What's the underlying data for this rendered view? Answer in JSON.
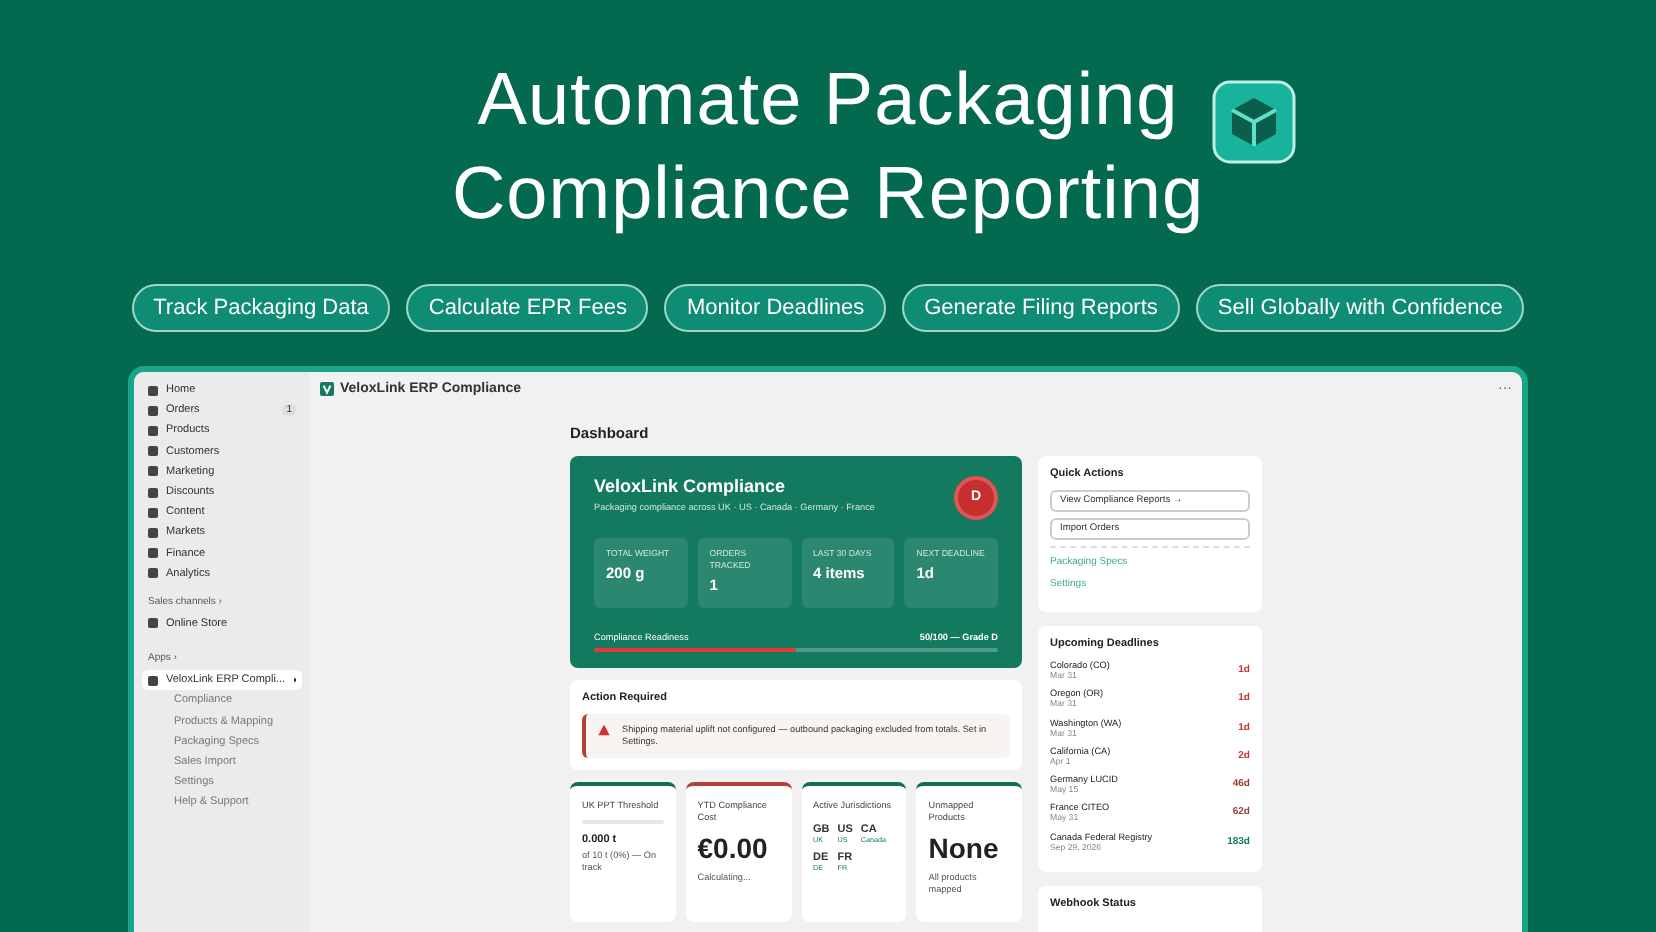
{
  "headline": [
    "Automate Packaging",
    "Compliance Reporting"
  ],
  "features": [
    "Track Packaging Data",
    "Calculate EPR Fees",
    "Monitor Deadlines",
    "Generate Filing Reports",
    "Sell Globally with Confidence"
  ],
  "sidebar": {
    "items": [
      {
        "label": "Home",
        "selected": false
      },
      {
        "label": "Orders",
        "badge": "1",
        "selected": false
      },
      {
        "label": "Products",
        "selected": false
      },
      {
        "label": "Customers",
        "selected": false
      },
      {
        "label": "Marketing",
        "selected": false
      },
      {
        "label": "Discounts",
        "selected": false
      },
      {
        "label": "Content",
        "selected": false
      },
      {
        "label": "Markets",
        "selected": false
      },
      {
        "label": "Finance",
        "selected": false
      },
      {
        "label": "Analytics",
        "selected": false
      }
    ],
    "sales_channels_label": "Sales channels ›",
    "channels": [
      {
        "label": "Online Store",
        "selected": false
      }
    ],
    "apps_label": "Apps ›",
    "app_item": {
      "label": "VeloxLink ERP Compli...",
      "selected": true
    },
    "sub_items": [
      {
        "label": "Compliance",
        "selected": false
      },
      {
        "label": "Products & Mapping",
        "selected": false
      },
      {
        "label": "Packaging Specs",
        "selected": false
      },
      {
        "label": "Sales Import",
        "selected": false
      },
      {
        "label": "Settings",
        "selected": false
      },
      {
        "label": "Help & Support",
        "selected": false
      }
    ]
  },
  "header_title": "VeloxLink ERP Compliance",
  "menu_glyph": "···",
  "page_title": "Dashboard",
  "summary": {
    "title": "VeloxLink Compliance",
    "subtitle": "Packaging compliance across UK · US · Canada · Germany · France",
    "avatar": "D",
    "stats": [
      {
        "label": "TOTAL WEIGHT",
        "value": "200 g"
      },
      {
        "label": "ORDERS TRACKED",
        "value": "1"
      },
      {
        "label": "LAST 30 DAYS",
        "value": "4 items"
      },
      {
        "label": "NEXT DEADLINE",
        "value": "1d"
      }
    ],
    "readiness_label": "Compliance Readiness",
    "readiness_value": "50/100 — Grade D",
    "level": 0.5
  },
  "action": {
    "title": "Action Required",
    "message": "Shipping material uplift not configured — outbound packaging excluded from totals. Set in Settings."
  },
  "cards": [
    {
      "kind": "threshold",
      "title": "UK PPT Threshold",
      "color": "#0f6e56",
      "level": 0,
      "value": "0.000 t",
      "note": "of 10 t (0%) — On track"
    },
    {
      "kind": "cost",
      "title": "YTD Compliance Cost",
      "color": "#b5403a",
      "value": "€0.00",
      "note": "Calculating..."
    },
    {
      "kind": "jurisdictions",
      "title": "Active Jurisdictions",
      "color": "#0f6e56",
      "codes": [
        {
          "code": "GB",
          "name": "UK"
        },
        {
          "code": "US",
          "name": "US"
        },
        {
          "code": "CA",
          "name": "Canada"
        },
        {
          "code": "DE",
          "name": "DE"
        },
        {
          "code": "FR",
          "name": "FR"
        }
      ]
    },
    {
      "kind": "unmapped",
      "title": "Unmapped Products",
      "color": "#0f6e56",
      "value": "None",
      "note": "All products mapped"
    }
  ],
  "quick_actions": {
    "title": "Quick Actions",
    "buttons": [
      "View Compliance Reports →",
      "Import Orders"
    ],
    "links": [
      "Packaging Specs",
      "Settings"
    ]
  },
  "deadlines": {
    "title": "Upcoming Deadlines",
    "items": [
      {
        "name": "Colorado (CO)",
        "date": "Mar 31",
        "days": "1d",
        "color": "#d32f2f"
      },
      {
        "name": "Oregon (OR)",
        "date": "Mar 31",
        "days": "1d",
        "color": "#d32f2f"
      },
      {
        "name": "Washington (WA)",
        "date": "Mar 31",
        "days": "1d",
        "color": "#d32f2f"
      },
      {
        "name": "California (CA)",
        "date": "Apr 1",
        "days": "2d",
        "color": "#d32f2f"
      },
      {
        "name": "Germany LUCID",
        "date": "May 15",
        "days": "46d",
        "color": "#9a3b2c"
      },
      {
        "name": "France CITEO",
        "date": "May 31",
        "days": "62d",
        "color": "#8a4a3c"
      },
      {
        "name": "Canada Federal Registry",
        "date": "Sep 29, 2026",
        "days": "183d",
        "color": "#0f7a5e"
      }
    ]
  },
  "webhook": {
    "title": "Webhook Status"
  }
}
